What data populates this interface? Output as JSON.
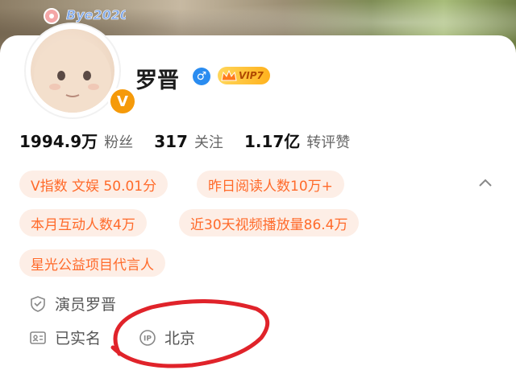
{
  "profile": {
    "avatar_sticker_text": "Bye2020",
    "verified_badge": "V",
    "name": "罗晋",
    "gender_icon": "male-icon",
    "vip_label": "VIP7"
  },
  "stats": [
    {
      "value": "1994.9万",
      "label": "粉丝"
    },
    {
      "value": "317",
      "label": "关注"
    },
    {
      "value": "1.17亿",
      "label": "转评赞"
    }
  ],
  "tags": [
    "V指数 文娱 50.01分",
    "昨日阅读人数10万+",
    "本月互动人数4万",
    "近30天视频播放量86.4万",
    "星光公益项目代言人"
  ],
  "info": {
    "occupation": "演员罗晋",
    "realname": "已实名",
    "ip_label": "IP",
    "ip_location": "北京"
  },
  "colors": {
    "accent": "#ff6a2a",
    "chip_bg": "#fdeee6",
    "verified": "#f59a0a",
    "gender": "#2a8cf0",
    "annotation": "#e0232a"
  }
}
